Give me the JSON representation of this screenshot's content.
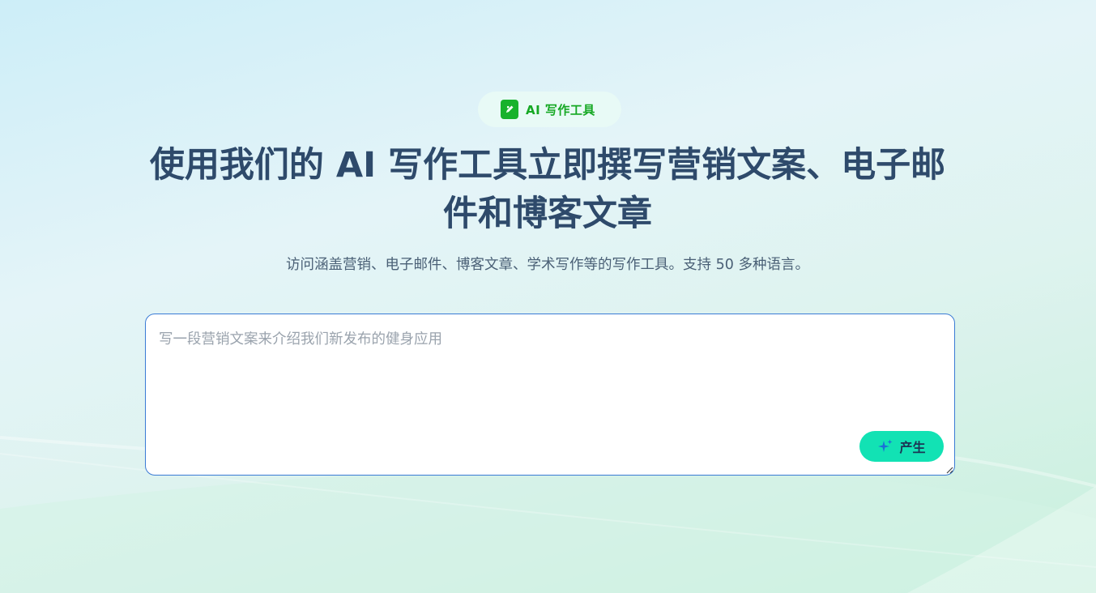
{
  "badge": {
    "label": "AI 写作工具",
    "icon": "pen-note-icon",
    "color": "#18b22c"
  },
  "hero": {
    "title": "使用我们的 AI 写作工具立即撰写营销文案、电子邮件和博客文章",
    "subtitle": "访问涵盖营销、电子邮件、博客文章、学术写作等的写作工具。支持 50 多种语言。"
  },
  "composer": {
    "placeholder": "写一段营销文案来介绍我们新发布的健身应用",
    "value": "",
    "generate_label": "产生",
    "generate_icon": "sparkle-icon",
    "accent": "#12e2b4",
    "border": "#3a7bd5"
  }
}
